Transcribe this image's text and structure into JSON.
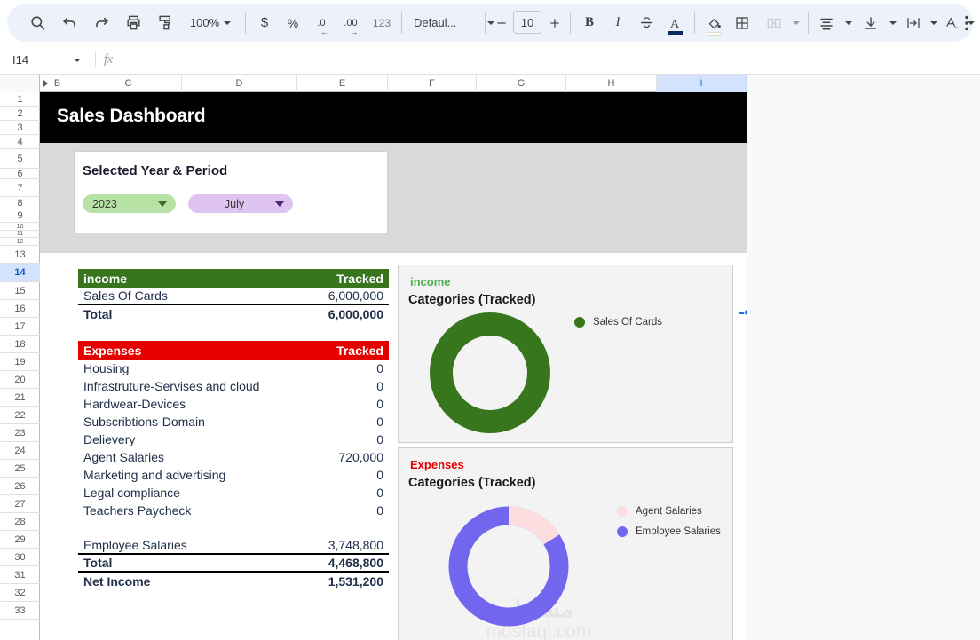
{
  "toolbar": {
    "zoom_label": "100%",
    "font_label": "Defaul...",
    "font_size": "10",
    "number_format_123": "123",
    "currency_symbol": "$",
    "percent_symbol": "%",
    "decrease_decimal": ".0",
    "increase_decimal": ".00",
    "bold": "B",
    "italic": "I"
  },
  "formula_bar": {
    "name_box": "I14",
    "fx_label": "fx",
    "formula_value": ""
  },
  "grid": {
    "columns": [
      "B",
      "C",
      "D",
      "E",
      "F",
      "G",
      "H",
      "I"
    ],
    "selected_column": "I",
    "rows": [
      "1",
      "2",
      "3",
      "4",
      "5",
      "6",
      "7",
      "8",
      "9",
      "10",
      "11",
      "12",
      "13",
      "14",
      "15",
      "16",
      "17",
      "18",
      "19",
      "20",
      "21",
      "22",
      "23",
      "24",
      "25",
      "26",
      "27",
      "28",
      "29",
      "30",
      "31",
      "32",
      "33"
    ],
    "selected_row": "14",
    "selected_cell": "I14"
  },
  "dashboard": {
    "banner_title": "Sales Dashboard",
    "period_card": {
      "title": "Selected Year & Period",
      "year_value": "2023",
      "period_value": "July"
    },
    "income_table": {
      "header_label": "income",
      "header_value": "Tracked",
      "rows": [
        {
          "label": "Sales Of Cards",
          "value": "6,000,000"
        }
      ],
      "total_label": "Total",
      "total_value": "6,000,000"
    },
    "expenses_table": {
      "header_label": "Expenses",
      "header_value": "Tracked",
      "rows": [
        {
          "label": "Housing",
          "value": "0"
        },
        {
          "label": "Infrastruture-Servises and cloud",
          "value": "0"
        },
        {
          "label": "Hardwear-Devices",
          "value": "0"
        },
        {
          "label": "Subscribtions-Domain",
          "value": "0"
        },
        {
          "label": "Delievery",
          "value": "0"
        },
        {
          "label": "Agent Salaries",
          "value": "720,000"
        },
        {
          "label": "Marketing and advertising",
          "value": "0"
        },
        {
          "label": "Legal compliance",
          "value": "0"
        },
        {
          "label": "Teachers Paycheck",
          "value": "0"
        }
      ],
      "employee_label": "Employee Salaries",
      "employee_value": "3,748,800",
      "total_label": "Total",
      "total_value": "4,468,800",
      "net_income_label": "Net Income",
      "net_income_value": "1,531,200"
    },
    "watermark": {
      "arabic": "مستقل",
      "latin": "mostaql.com"
    }
  },
  "chart_data": [
    {
      "id": "income_donut",
      "type": "pie",
      "title": "income",
      "subtitle": "Categories (Tracked)",
      "legend_position": "right",
      "categories": [
        "Sales Of Cards"
      ],
      "values": [
        6000000
      ],
      "percents": [
        100
      ],
      "colors": [
        "#38761d"
      ]
    },
    {
      "id": "expenses_donut",
      "type": "pie",
      "title": "Expenses",
      "subtitle": "Categories (Tracked)",
      "legend_position": "right",
      "categories": [
        "Agent Salaries",
        "Employee Salaries"
      ],
      "values": [
        720000,
        3748800
      ],
      "percents": [
        16.1,
        83.9
      ],
      "colors": [
        "#fcdede",
        "#7265ee"
      ]
    }
  ]
}
